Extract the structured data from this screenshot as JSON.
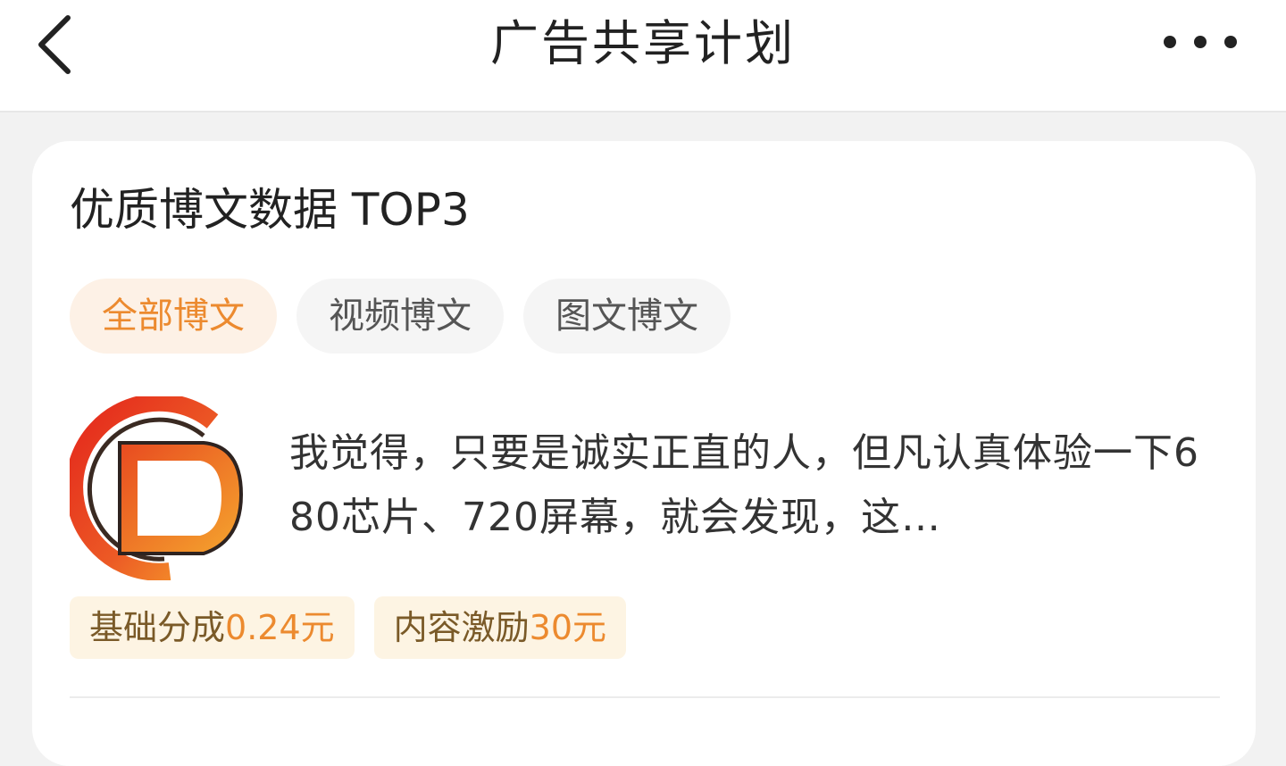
{
  "header": {
    "title": "广告共享计划"
  },
  "card": {
    "title": "优质博文数据 TOP3",
    "tabs": [
      {
        "label": "全部博文",
        "active": true
      },
      {
        "label": "视频博文",
        "active": false
      },
      {
        "label": "图文博文",
        "active": false
      }
    ],
    "post": {
      "text": "我觉得，只要是诚实正直的人，但凡认真体验一下680芯片、720屏幕，就会发现，这…"
    },
    "badges": [
      {
        "label": "基础分成",
        "value": "0.24元"
      },
      {
        "label": "内容激励",
        "value": "30元"
      }
    ]
  },
  "colors": {
    "accent": "#ec8a2f",
    "badge_bg": "#fdf4e3",
    "tab_active_bg": "#fdf1e6"
  },
  "icons": {
    "back": "chevron-left-icon",
    "more": "more-dots-icon"
  }
}
